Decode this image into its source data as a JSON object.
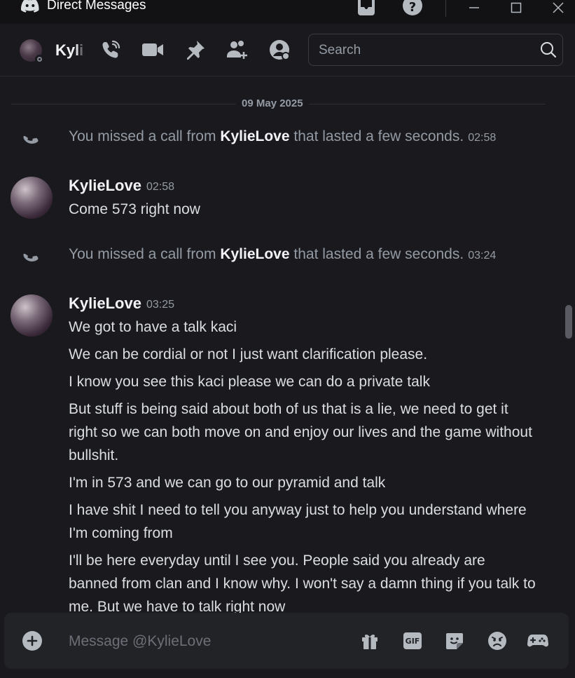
{
  "window": {
    "title": "Direct Messages"
  },
  "header": {
    "user_name": "KylieLove",
    "search_placeholder": "Search"
  },
  "date_divider": "09 May 2025",
  "calls": [
    {
      "prefix": "You missed a call from ",
      "name": "KylieLove",
      "suffix": " that lasted a few seconds.",
      "time": "02:58"
    },
    {
      "prefix": "You missed a call from ",
      "name": "KylieLove",
      "suffix": " that lasted a few seconds.",
      "time": "03:24"
    }
  ],
  "messages": [
    {
      "author": "KylieLove",
      "time": "02:58",
      "lines": [
        "Come 573 right now"
      ]
    },
    {
      "author": "KylieLove",
      "time": "03:25",
      "lines": [
        "We got to have a talk kaci",
        "We can be cordial or not I just want clarification please.",
        "I know you see this kaci please we can do a private talk",
        "But stuff is being said about both of us that is a lie, we need to get it right so we can both move on and enjoy our lives and the game without bullshit.",
        "I'm in 573 and we can go to our pyramid and talk",
        "I have shit I need to tell you anyway just to help you understand where I'm coming from",
        "I'll be here everyday until I see you. People said you already are banned from clan and I know why. I won't say a damn thing if you talk to me. But we have to talk right now"
      ]
    }
  ],
  "composer": {
    "placeholder": "Message @KylieLove",
    "gif_label": "GIF"
  },
  "colors": {
    "background": "#1a1a1e",
    "titlebar": "#121214",
    "composer": "#222327",
    "text_muted": "#949ba4",
    "text_normal": "#dbdee1",
    "text_strong": "#f2f3f5"
  },
  "icons": {
    "titlebar": [
      "discord-logo-icon",
      "inbox-icon",
      "help-icon",
      "minimize-icon",
      "maximize-icon",
      "close-icon"
    ],
    "header": [
      "voice-call-icon",
      "video-call-icon",
      "pin-icon",
      "add-friends-icon",
      "user-profile-icon",
      "search-icon"
    ],
    "composer": [
      "add-attachment-icon",
      "gift-icon",
      "gif-icon",
      "sticker-icon",
      "emoji-icon",
      "apps-icon"
    ]
  }
}
